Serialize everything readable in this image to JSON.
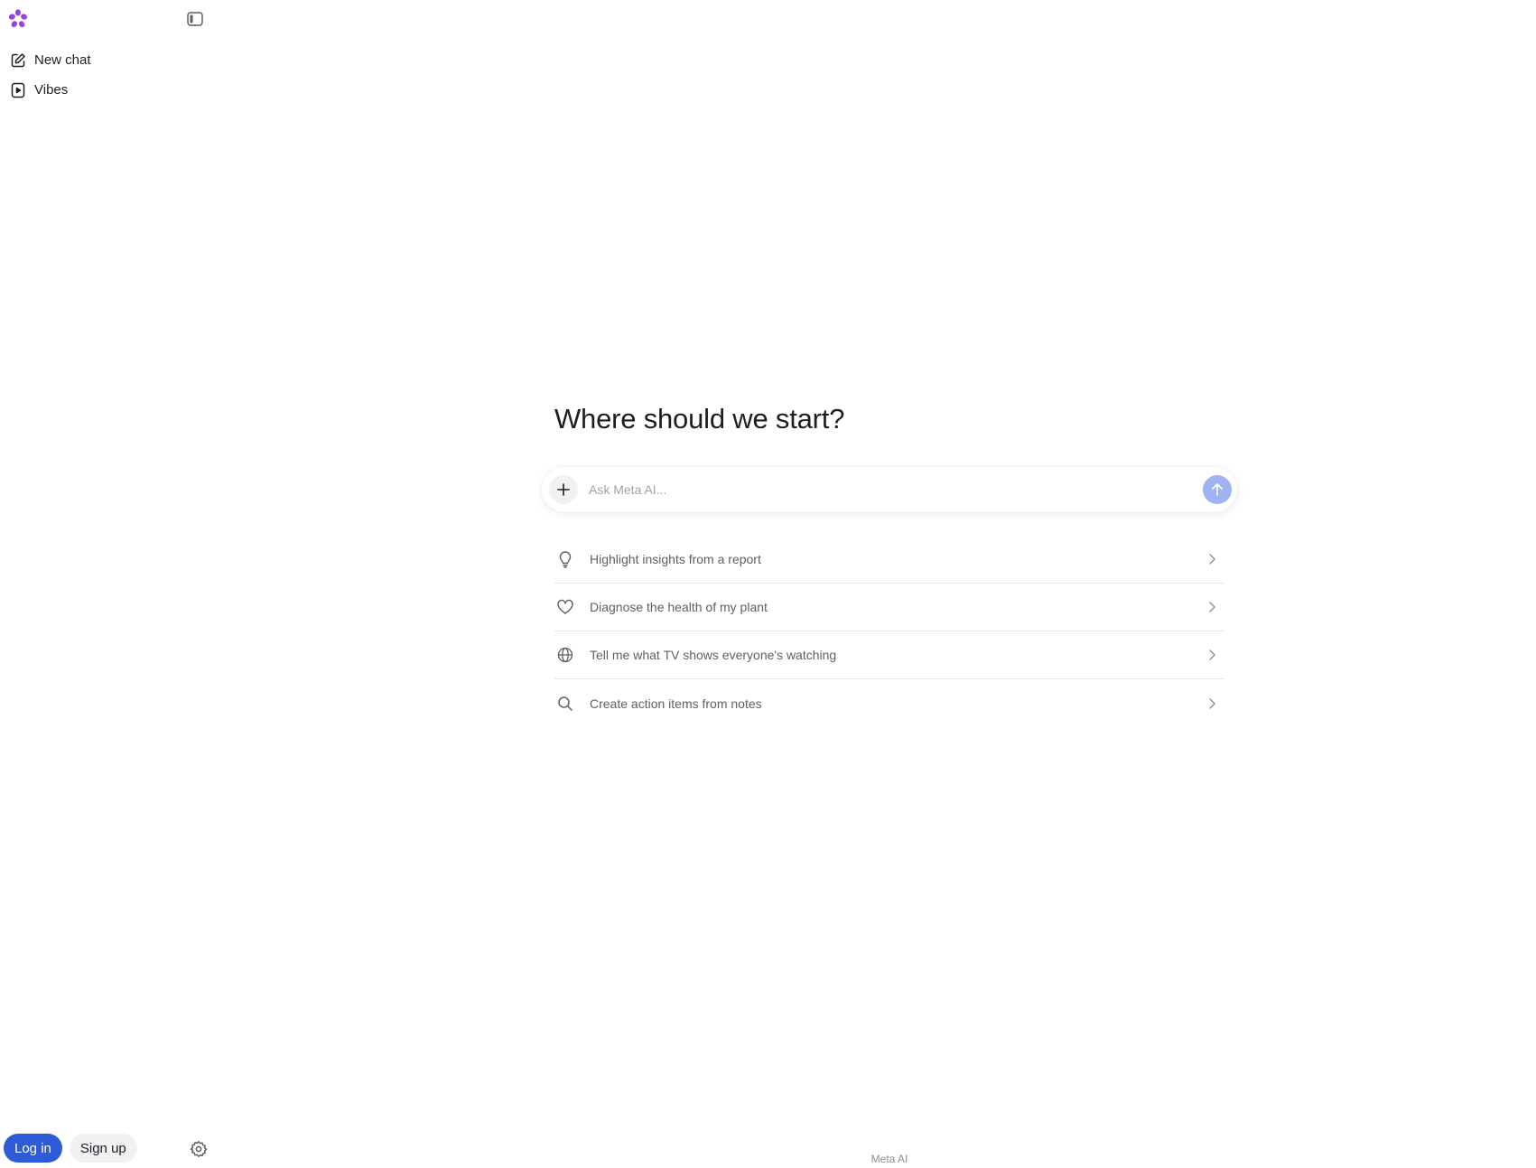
{
  "sidebar": {
    "logo_icon": "meta-ai-flower-icon",
    "toggle_icon": "sidebar-toggle-icon",
    "items": [
      {
        "label": "New chat",
        "icon": "edit-icon"
      },
      {
        "label": "Vibes",
        "icon": "play-square-icon"
      }
    ],
    "auth": {
      "login_label": "Log in",
      "signup_label": "Sign up"
    },
    "settings_icon": "gear-icon"
  },
  "main": {
    "heading": "Where should we start?",
    "composer": {
      "placeholder": "Ask Meta AI...",
      "value": "",
      "add_icon": "plus-icon",
      "send_icon": "arrow-up-icon"
    },
    "suggestions": [
      {
        "label": "Highlight insights from a report",
        "icon": "lightbulb-icon"
      },
      {
        "label": "Diagnose the health of my plant",
        "icon": "heart-icon"
      },
      {
        "label": "Tell me what TV shows everyone's watching",
        "icon": "globe-icon"
      },
      {
        "label": "Create action items from notes",
        "icon": "search-icon"
      }
    ],
    "footer": "Meta AI"
  },
  "colors": {
    "accent": "#2d5bd6",
    "send_button": "#9fb3f2",
    "logo_start": "#6a3de8",
    "logo_end": "#c34bd8"
  }
}
